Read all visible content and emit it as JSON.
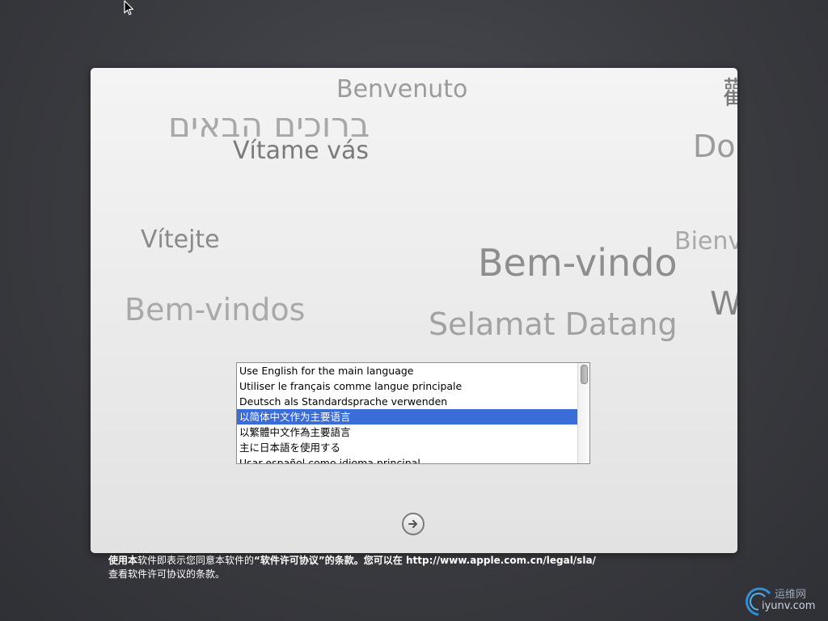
{
  "welcome_words": {
    "benvenuto": "Benvenuto",
    "hebrew": "ברוכים הבאים",
    "vitame": "Vítame vás",
    "chinese": "歡",
    "do": "Do",
    "vitejte": "Vítejte",
    "bienv": "Bienv",
    "bem_vindo": "Bem-vindo",
    "bem_vindos": "Bem-vindos",
    "w": "W",
    "selamat": "Selamat Datang"
  },
  "language_list": {
    "items": [
      {
        "label": "Use English for the main language",
        "selected": false
      },
      {
        "label": "Utiliser le français comme langue principale",
        "selected": false
      },
      {
        "label": "Deutsch als Standardsprache verwenden",
        "selected": false
      },
      {
        "label": "以简体中文作为主要语言",
        "selected": true
      },
      {
        "label": "以繁體中文作為主要語言",
        "selected": false
      },
      {
        "label": "主に日本語を使用する",
        "selected": false
      },
      {
        "label": "Usar español como idioma principal",
        "selected": false
      }
    ],
    "selected_color": "#3b6dd8"
  },
  "next_button": {
    "icon": "arrow-right-circle-icon"
  },
  "footer": {
    "bold_prefix": "使用本",
    "text1": "软件即表示您同意本软件的",
    "quoted": "“软件许可协议”的条款。您可以在 http://www.apple.com.cn/legal/sla/",
    "line2": "查看软件许可协议的条款。"
  },
  "watermark": {
    "line1": "运维网",
    "line2": "iyunv.com"
  }
}
